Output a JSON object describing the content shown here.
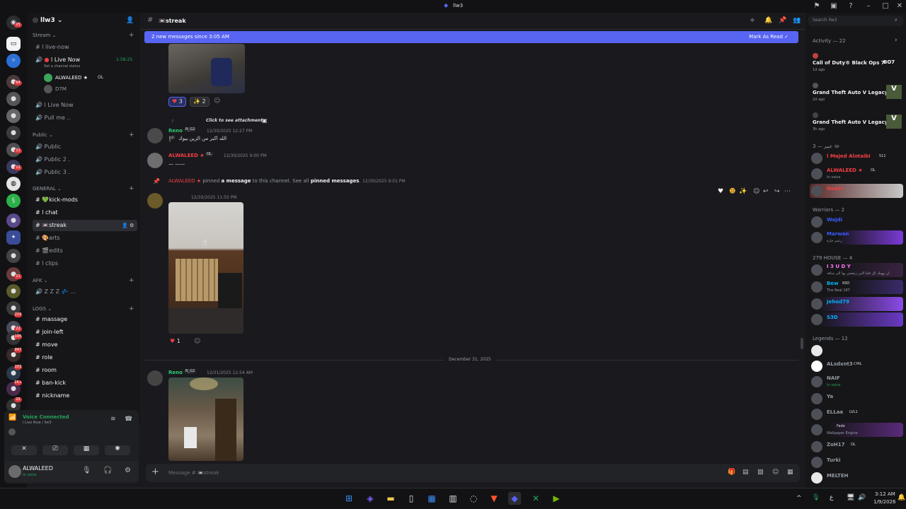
{
  "window": {
    "title": "llw3"
  },
  "titlebar_icons": [
    "flag-icon",
    "inbox-icon",
    "help-icon"
  ],
  "server": {
    "name": "llw3"
  },
  "guild_badges": [
    "25",
    "64",
    "21",
    "12",
    "145",
    "847",
    "103",
    "1K+",
    "11",
    "219",
    "15",
    "22",
    "4",
    "2"
  ],
  "categories": {
    "stream": "Stream",
    "public": "Public",
    "general": "GENERAL",
    "afk": "AFK",
    "logs": "LOGS"
  },
  "channels": {
    "stream": [
      {
        "label": "l live-now"
      },
      {
        "label": "l Live Now",
        "timer": "1:58:25",
        "status": "Set a channel status"
      },
      {
        "label": "l Live Now"
      },
      {
        "label": "Pull me .."
      }
    ],
    "voice_users": [
      {
        "name": "ALWALEED ★",
        "tag": "OL"
      },
      {
        "name": "D7M"
      }
    ],
    "public": [
      "Public",
      "Public 2 .",
      "Public 3 ."
    ],
    "general": [
      "💚kick-mods",
      "l chat",
      "📼streak",
      "🎨arts",
      "🎬edits",
      "l clips"
    ],
    "afk": [
      "Z Z Z 💤 ..."
    ],
    "logs": [
      "massage",
      "join-left",
      "move",
      "role",
      "room",
      "ban-kick",
      "nickname"
    ]
  },
  "voice": {
    "status": "Voice Connected",
    "location": "l Live Now / llw3"
  },
  "user": {
    "name": "ALWALEED",
    "status": "In voice"
  },
  "header": {
    "channel": "📼streak",
    "search_placeholder": "Search llw3"
  },
  "banner": {
    "text": "2 new messages since 3:05 AM",
    "action": "Mark As Read"
  },
  "messages": {
    "reactions1": [
      {
        "emoji": "♥",
        "count": "3"
      },
      {
        "emoji": "✨",
        "count": "2"
      }
    ],
    "reply_hint": "Click to see attachment",
    "reno1": {
      "name": "Reno",
      "tag": "N_G2",
      "time": "12/30/2025 12:27 PM",
      "text": "الله اكبر من الزين يبوك"
    },
    "alw": {
      "name": "ALWALEED ★",
      "tag": "OL",
      "time": "12/30/2025 9:00 PM",
      "text": "— ——"
    },
    "pin": {
      "name": "ALWALEED ★",
      "mid1": "pinned",
      "link1": "a message",
      "mid2": "to this channel. See all",
      "link2": "pinned messages",
      "time": "12/30/2025 9:01 PM"
    },
    "photo_msg": {
      "time": "12/30/2025 11:55 PM"
    },
    "reaction2": {
      "emoji": "♥",
      "count": "1"
    },
    "divider": "December 31, 2025",
    "reno2": {
      "name": "Reno",
      "tag": "N_G2",
      "time": "12/31/2025 12:54 AM"
    }
  },
  "input": {
    "placeholder": "Message # 📼streak"
  },
  "activity": {
    "header": "Activity — 22",
    "items": [
      {
        "game": "Call of Duty® Black Ops 7",
        "ago": "1d ago",
        "badge": "BO7"
      },
      {
        "game": "Grand Theft Auto V Legacy",
        "ago": "2d ago",
        "badge": "V"
      },
      {
        "game": "Grand Theft Auto V Legacy",
        "ago": "3h ago",
        "badge": "V"
      }
    ]
  },
  "member_groups": {
    "g1": "ﷻ عبير — 3",
    "warriors": "Warriors — 2",
    "house": "279 HOUSE — 4",
    "legends": "Legends — 12"
  },
  "members": {
    "g1": [
      {
        "name": "l Majed Alotaibi",
        "tag": "511",
        "color": "#f23f43"
      },
      {
        "name": "ALWALEED ★",
        "tag": "OL",
        "sub": "In voice",
        "color": "#f23f43"
      },
      {
        "name": "Nader",
        "color": "#f23f43"
      }
    ],
    "warriors": [
      {
        "name": "Wajdi",
        "color": "#3b5bff"
      },
      {
        "name": "Marwan",
        "sub": "زعيم حارة",
        "color": "#3b5bff"
      }
    ],
    "house": [
      {
        "name": "I 3 U D Y",
        "sub": "ان يهمك كل قلبا التي زنجعني بها الى منافة",
        "color": "#ff73fa"
      },
      {
        "name": "Bew",
        "tag": "69D",
        "sub": "The Real 187",
        "color": "#00b0f4"
      },
      {
        "name": "Jehod79",
        "color": "#00b0f4"
      },
      {
        "name": "S3D",
        "color": "#00b0f4"
      }
    ],
    "legends": [
      {
        "name": "",
        "color": "#949ba4"
      },
      {
        "name": "ALsdxnt3",
        "tag": "CHIL",
        "color": "#949ba4"
      },
      {
        "name": "NAIF",
        "sub": "In voice",
        "color": "#949ba4"
      },
      {
        "name": "Ya",
        "color": "#949ba4"
      },
      {
        "name": "ELLaa",
        "tag": "LVL1",
        "color": "#949ba4"
      },
      {
        "name": "",
        "tag": "Fade",
        "sub": "Wallpaper Engine",
        "color": "#949ba4"
      },
      {
        "name": "ZoH17",
        "tag": "OL",
        "color": "#949ba4"
      },
      {
        "name": "Turki",
        "color": "#949ba4"
      },
      {
        "name": "MELTEH",
        "color": "#949ba4"
      }
    ]
  },
  "clock": {
    "time": "3:12 AM",
    "date": "1/9/2026",
    "lang": "ع"
  }
}
